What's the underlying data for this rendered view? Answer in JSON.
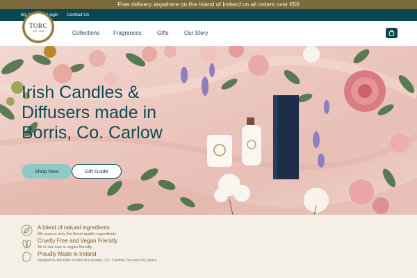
{
  "announcement": "Free delivery anywhere on the Island of Ireland on all orders over €50",
  "utility": {
    "account": "My Account",
    "login": "Login",
    "contact": "Contact Us"
  },
  "logo": {
    "name": "TORC",
    "tagline": "EST. 1989"
  },
  "nav": [
    "Collections",
    "Fragrances",
    "Gifts",
    "Our Story"
  ],
  "hero": {
    "headline": "Irish Candles & Diffusers made in Borris, Co. Carlow",
    "primary_button": "Shop Now",
    "secondary_button": "Gift Guide"
  },
  "features": [
    {
      "title": "A blend of natural ingredients",
      "desc": "We source only the finest quality ingredients",
      "icon": "leaf-icon"
    },
    {
      "title": "Cruelty Free and Vegan Friendly",
      "desc": "All of our wax is vegan friendly",
      "icon": "vegan-icon"
    },
    {
      "title": "Proudly Made in Ireland",
      "desc": "Nestled in the hills of Mount Leinster, Co. Carlow, for over 50 years",
      "icon": "ireland-map-icon"
    }
  ],
  "colors": {
    "brand_teal": "#0b4750",
    "gold": "#7a6a3c",
    "button_mint": "#8fc9c6",
    "hero_pink": "#ecc7bf"
  },
  "icons": {
    "cart": "shopping-bag-icon"
  }
}
